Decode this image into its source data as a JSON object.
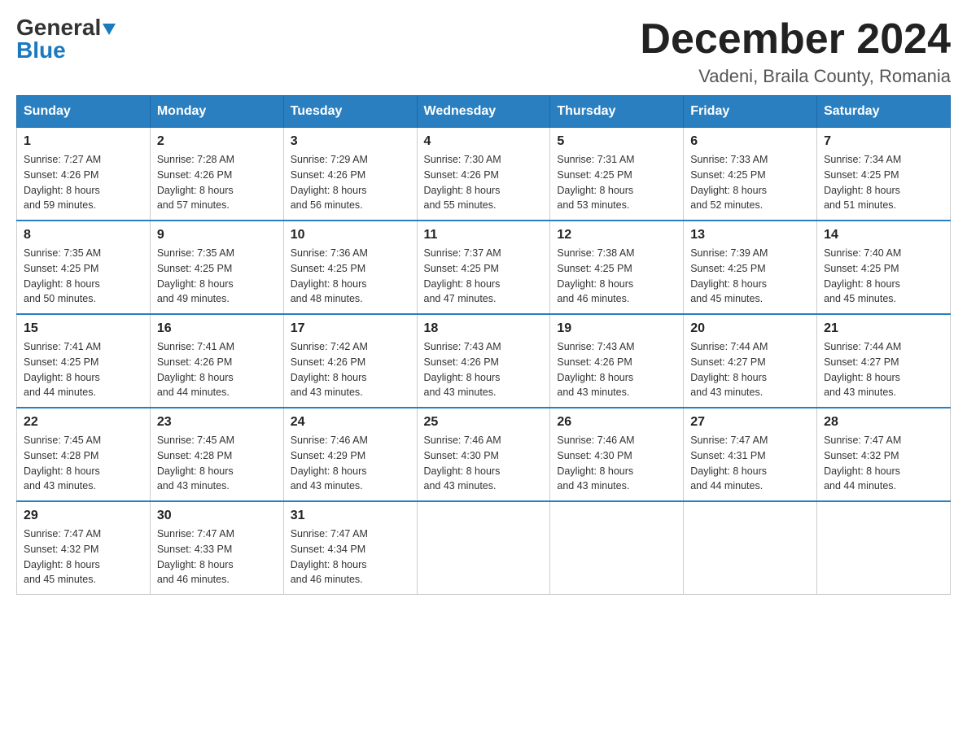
{
  "header": {
    "logo_line1": "General",
    "logo_line2": "Blue",
    "month_title": "December 2024",
    "location": "Vadeni, Braila County, Romania"
  },
  "weekdays": [
    "Sunday",
    "Monday",
    "Tuesday",
    "Wednesday",
    "Thursday",
    "Friday",
    "Saturday"
  ],
  "weeks": [
    [
      {
        "day": "1",
        "sunrise": "7:27 AM",
        "sunset": "4:26 PM",
        "daylight": "8 hours and 59 minutes."
      },
      {
        "day": "2",
        "sunrise": "7:28 AM",
        "sunset": "4:26 PM",
        "daylight": "8 hours and 57 minutes."
      },
      {
        "day": "3",
        "sunrise": "7:29 AM",
        "sunset": "4:26 PM",
        "daylight": "8 hours and 56 minutes."
      },
      {
        "day": "4",
        "sunrise": "7:30 AM",
        "sunset": "4:26 PM",
        "daylight": "8 hours and 55 minutes."
      },
      {
        "day": "5",
        "sunrise": "7:31 AM",
        "sunset": "4:25 PM",
        "daylight": "8 hours and 53 minutes."
      },
      {
        "day": "6",
        "sunrise": "7:33 AM",
        "sunset": "4:25 PM",
        "daylight": "8 hours and 52 minutes."
      },
      {
        "day": "7",
        "sunrise": "7:34 AM",
        "sunset": "4:25 PM",
        "daylight": "8 hours and 51 minutes."
      }
    ],
    [
      {
        "day": "8",
        "sunrise": "7:35 AM",
        "sunset": "4:25 PM",
        "daylight": "8 hours and 50 minutes."
      },
      {
        "day": "9",
        "sunrise": "7:35 AM",
        "sunset": "4:25 PM",
        "daylight": "8 hours and 49 minutes."
      },
      {
        "day": "10",
        "sunrise": "7:36 AM",
        "sunset": "4:25 PM",
        "daylight": "8 hours and 48 minutes."
      },
      {
        "day": "11",
        "sunrise": "7:37 AM",
        "sunset": "4:25 PM",
        "daylight": "8 hours and 47 minutes."
      },
      {
        "day": "12",
        "sunrise": "7:38 AM",
        "sunset": "4:25 PM",
        "daylight": "8 hours and 46 minutes."
      },
      {
        "day": "13",
        "sunrise": "7:39 AM",
        "sunset": "4:25 PM",
        "daylight": "8 hours and 45 minutes."
      },
      {
        "day": "14",
        "sunrise": "7:40 AM",
        "sunset": "4:25 PM",
        "daylight": "8 hours and 45 minutes."
      }
    ],
    [
      {
        "day": "15",
        "sunrise": "7:41 AM",
        "sunset": "4:25 PM",
        "daylight": "8 hours and 44 minutes."
      },
      {
        "day": "16",
        "sunrise": "7:41 AM",
        "sunset": "4:26 PM",
        "daylight": "8 hours and 44 minutes."
      },
      {
        "day": "17",
        "sunrise": "7:42 AM",
        "sunset": "4:26 PM",
        "daylight": "8 hours and 43 minutes."
      },
      {
        "day": "18",
        "sunrise": "7:43 AM",
        "sunset": "4:26 PM",
        "daylight": "8 hours and 43 minutes."
      },
      {
        "day": "19",
        "sunrise": "7:43 AM",
        "sunset": "4:26 PM",
        "daylight": "8 hours and 43 minutes."
      },
      {
        "day": "20",
        "sunrise": "7:44 AM",
        "sunset": "4:27 PM",
        "daylight": "8 hours and 43 minutes."
      },
      {
        "day": "21",
        "sunrise": "7:44 AM",
        "sunset": "4:27 PM",
        "daylight": "8 hours and 43 minutes."
      }
    ],
    [
      {
        "day": "22",
        "sunrise": "7:45 AM",
        "sunset": "4:28 PM",
        "daylight": "8 hours and 43 minutes."
      },
      {
        "day": "23",
        "sunrise": "7:45 AM",
        "sunset": "4:28 PM",
        "daylight": "8 hours and 43 minutes."
      },
      {
        "day": "24",
        "sunrise": "7:46 AM",
        "sunset": "4:29 PM",
        "daylight": "8 hours and 43 minutes."
      },
      {
        "day": "25",
        "sunrise": "7:46 AM",
        "sunset": "4:30 PM",
        "daylight": "8 hours and 43 minutes."
      },
      {
        "day": "26",
        "sunrise": "7:46 AM",
        "sunset": "4:30 PM",
        "daylight": "8 hours and 43 minutes."
      },
      {
        "day": "27",
        "sunrise": "7:47 AM",
        "sunset": "4:31 PM",
        "daylight": "8 hours and 44 minutes."
      },
      {
        "day": "28",
        "sunrise": "7:47 AM",
        "sunset": "4:32 PM",
        "daylight": "8 hours and 44 minutes."
      }
    ],
    [
      {
        "day": "29",
        "sunrise": "7:47 AM",
        "sunset": "4:32 PM",
        "daylight": "8 hours and 45 minutes."
      },
      {
        "day": "30",
        "sunrise": "7:47 AM",
        "sunset": "4:33 PM",
        "daylight": "8 hours and 46 minutes."
      },
      {
        "day": "31",
        "sunrise": "7:47 AM",
        "sunset": "4:34 PM",
        "daylight": "8 hours and 46 minutes."
      },
      null,
      null,
      null,
      null
    ]
  ],
  "labels": {
    "sunrise": "Sunrise:",
    "sunset": "Sunset:",
    "daylight": "Daylight:"
  }
}
